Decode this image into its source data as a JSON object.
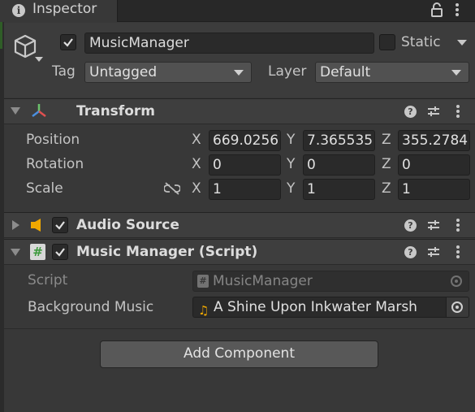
{
  "tab": {
    "title": "Inspector",
    "icon": "info-icon"
  },
  "header": {
    "object_name": "MusicManager",
    "active": true,
    "static_label": "Static",
    "static_checked": false,
    "tag_label": "Tag",
    "tag_value": "Untagged",
    "layer_label": "Layer",
    "layer_value": "Default"
  },
  "transform": {
    "title": "Transform",
    "position_label": "Position",
    "rotation_label": "Rotation",
    "scale_label": "Scale",
    "axis_x": "X",
    "axis_y": "Y",
    "axis_z": "Z",
    "position": {
      "x": "669.0256",
      "y": "7.365535",
      "z": "355.2784"
    },
    "rotation": {
      "x": "0",
      "y": "0",
      "z": "0"
    },
    "scale": {
      "x": "1",
      "y": "1",
      "z": "1"
    }
  },
  "audio_source": {
    "title": "Audio Source",
    "enabled": true
  },
  "music_manager": {
    "title": "Music Manager (Script)",
    "enabled": true,
    "script_label": "Script",
    "script_value": "MusicManager",
    "bg_music_label": "Background Music",
    "bg_music_value": "A Shine Upon Inkwater Marsh"
  },
  "add_component_label": "Add Component",
  "colors": {
    "panel": "#383838",
    "field": "#2a2a2a",
    "header": "#3e3e3e",
    "audio_icon": "#f0a800"
  }
}
